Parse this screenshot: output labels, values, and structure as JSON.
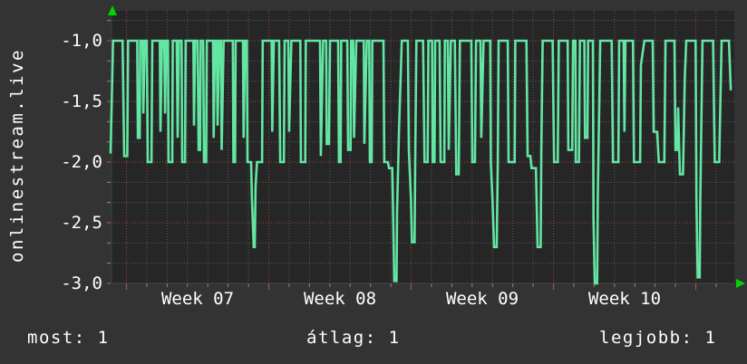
{
  "vertical_title": "onlinestream.live",
  "stats": {
    "left": "most: 1",
    "center": "átlag: 1",
    "right": "legjobb: 1"
  },
  "colors": {
    "background": "#333333",
    "canvas": "#262626",
    "grid_minor": "#5a5a5a",
    "grid_major": "#a04545",
    "line": "#63e6a3",
    "axis_arrow": "#00d400",
    "tick_minor": "#8a8a8a",
    "tick_major": "#c05050",
    "text": "#ffffff"
  },
  "chart_data": {
    "type": "line",
    "title": "",
    "ylabel_vertical": "onlinestream.live",
    "x_unit": "days",
    "xlim_days": [
      0,
      30.7
    ],
    "ylim": [
      -3.0,
      -1.0
    ],
    "grid": "dotted, minor every 1 day / 0.167 units, major (red) every 7 days / 0.5 units",
    "legend_position": "bottom",
    "y_ticks": [
      -1.0,
      -1.5,
      -2.0,
      -2.5,
      -3.0
    ],
    "y_tick_labels": [
      "-1,0",
      "-1,5",
      "-2,0",
      "-2,5",
      "-3,0"
    ],
    "x_tick_labels": [
      "Week 07",
      "Week 08",
      "Week 09",
      "Week 10"
    ],
    "week_boundaries_days": [
      0.78,
      7.78,
      14.78,
      21.78,
      28.78
    ],
    "series_name": "onlinestream.live",
    "points": [
      [
        0,
        -1.93
      ],
      [
        0.12,
        -1
      ],
      [
        0.59,
        -1
      ],
      [
        0.67,
        -1.95
      ],
      [
        0.82,
        -1.95
      ],
      [
        0.86,
        -1
      ],
      [
        1.31,
        -1
      ],
      [
        1.34,
        -1.8
      ],
      [
        1.43,
        -1.8
      ],
      [
        1.46,
        -1
      ],
      [
        1.57,
        -1
      ],
      [
        1.61,
        -1.6
      ],
      [
        1.68,
        -1
      ],
      [
        1.78,
        -1
      ],
      [
        1.83,
        -2
      ],
      [
        2.01,
        -2
      ],
      [
        2.05,
        -1
      ],
      [
        2.42,
        -1
      ],
      [
        2.45,
        -1.75
      ],
      [
        2.53,
        -1
      ],
      [
        2.64,
        -1
      ],
      [
        2.68,
        -1.6
      ],
      [
        2.73,
        -1
      ],
      [
        2.82,
        -1
      ],
      [
        2.85,
        -2
      ],
      [
        3.03,
        -2
      ],
      [
        3.06,
        -1
      ],
      [
        3.25,
        -1
      ],
      [
        3.3,
        -1.8
      ],
      [
        3.36,
        -1
      ],
      [
        3.49,
        -1
      ],
      [
        3.52,
        -2
      ],
      [
        3.66,
        -2
      ],
      [
        3.69,
        -1
      ],
      [
        4.07,
        -1
      ],
      [
        4.1,
        -1.7
      ],
      [
        4.16,
        -1
      ],
      [
        4.28,
        -1
      ],
      [
        4.33,
        -1.9
      ],
      [
        4.4,
        -1.9
      ],
      [
        4.43,
        -1
      ],
      [
        4.55,
        -1
      ],
      [
        4.59,
        -2
      ],
      [
        4.7,
        -2
      ],
      [
        4.73,
        -1
      ],
      [
        5.04,
        -1
      ],
      [
        5.07,
        -1.8
      ],
      [
        5.13,
        -1
      ],
      [
        5.22,
        -1
      ],
      [
        5.26,
        -1.7
      ],
      [
        5.34,
        -1
      ],
      [
        5.43,
        -1
      ],
      [
        5.46,
        -1.9
      ],
      [
        5.56,
        -1
      ],
      [
        6.01,
        -1
      ],
      [
        6.04,
        -2
      ],
      [
        6.12,
        -2
      ],
      [
        6.15,
        -1
      ],
      [
        6.51,
        -1
      ],
      [
        6.54,
        -1.8
      ],
      [
        6.61,
        -1
      ],
      [
        6.7,
        -1
      ],
      [
        6.73,
        -2
      ],
      [
        6.91,
        -2
      ],
      [
        6.95,
        -2.3
      ],
      [
        7.04,
        -2.7
      ],
      [
        7.09,
        -2.7
      ],
      [
        7.13,
        -2.2
      ],
      [
        7.2,
        -2
      ],
      [
        7.45,
        -2
      ],
      [
        7.48,
        -1
      ],
      [
        7.92,
        -1
      ],
      [
        7.95,
        -1.75
      ],
      [
        8.03,
        -1
      ],
      [
        8.29,
        -1
      ],
      [
        8.34,
        -2
      ],
      [
        8.52,
        -2
      ],
      [
        8.56,
        -1
      ],
      [
        8.74,
        -1
      ],
      [
        8.78,
        -1.75
      ],
      [
        8.89,
        -1
      ],
      [
        9.33,
        -1
      ],
      [
        9.36,
        -2
      ],
      [
        9.57,
        -2
      ],
      [
        9.6,
        -1
      ],
      [
        10.3,
        -1
      ],
      [
        10.34,
        -1.95
      ],
      [
        10.45,
        -1
      ],
      [
        10.6,
        -1
      ],
      [
        10.63,
        -1.85
      ],
      [
        10.74,
        -1.85
      ],
      [
        10.79,
        -1
      ],
      [
        11.19,
        -1
      ],
      [
        11.23,
        -2
      ],
      [
        11.31,
        -2
      ],
      [
        11.34,
        -1
      ],
      [
        11.64,
        -1
      ],
      [
        11.68,
        -1.9
      ],
      [
        11.8,
        -1.9
      ],
      [
        11.83,
        -1
      ],
      [
        11.93,
        -1
      ],
      [
        11.97,
        -1.8
      ],
      [
        12.08,
        -1
      ],
      [
        12.45,
        -1
      ],
      [
        12.48,
        -1.85
      ],
      [
        12.6,
        -1
      ],
      [
        12.72,
        -1
      ],
      [
        12.75,
        -2
      ],
      [
        12.84,
        -2
      ],
      [
        12.87,
        -1
      ],
      [
        13.42,
        -1
      ],
      [
        13.46,
        -2
      ],
      [
        13.64,
        -2
      ],
      [
        13.69,
        -2.05
      ],
      [
        13.85,
        -2.05
      ],
      [
        13.89,
        -2.4
      ],
      [
        13.95,
        -2.98
      ],
      [
        14.06,
        -2.98
      ],
      [
        14.09,
        -2.4
      ],
      [
        14.18,
        -1.75
      ],
      [
        14.32,
        -1
      ],
      [
        14.62,
        -1
      ],
      [
        14.67,
        -1.9
      ],
      [
        14.77,
        -2.3
      ],
      [
        14.82,
        -2.66
      ],
      [
        14.95,
        -2.66
      ],
      [
        14.98,
        -2
      ],
      [
        15.04,
        -1
      ],
      [
        15.37,
        -1
      ],
      [
        15.44,
        -2
      ],
      [
        15.59,
        -2
      ],
      [
        15.63,
        -1
      ],
      [
        15.81,
        -1
      ],
      [
        15.84,
        -2
      ],
      [
        15.93,
        -2
      ],
      [
        15.96,
        -1
      ],
      [
        16.18,
        -1
      ],
      [
        16.23,
        -2
      ],
      [
        16.41,
        -2
      ],
      [
        16.44,
        -1
      ],
      [
        16.58,
        -1
      ],
      [
        16.63,
        -1.9
      ],
      [
        16.73,
        -1
      ],
      [
        16.93,
        -1
      ],
      [
        17,
        -2.1
      ],
      [
        17.12,
        -2.1
      ],
      [
        17.18,
        -1
      ],
      [
        17.74,
        -1
      ],
      [
        17.79,
        -2
      ],
      [
        17.92,
        -2
      ],
      [
        17.97,
        -1
      ],
      [
        18.19,
        -1
      ],
      [
        18.23,
        -1.8
      ],
      [
        18.34,
        -1
      ],
      [
        18.67,
        -1
      ],
      [
        18.7,
        -2
      ],
      [
        18.78,
        -2.3
      ],
      [
        18.86,
        -2.7
      ],
      [
        18.99,
        -2.7
      ],
      [
        19.04,
        -2
      ],
      [
        19.08,
        -1
      ],
      [
        19.53,
        -1
      ],
      [
        19.57,
        -2
      ],
      [
        19.87,
        -2
      ],
      [
        19.9,
        -1
      ],
      [
        20.45,
        -1
      ],
      [
        20.51,
        -1.95
      ],
      [
        20.64,
        -1.95
      ],
      [
        20.7,
        -2.05
      ],
      [
        20.92,
        -2.05
      ],
      [
        21,
        -2.7
      ],
      [
        21.15,
        -2.7
      ],
      [
        21.18,
        -1.9
      ],
      [
        21.25,
        -1
      ],
      [
        21.74,
        -1
      ],
      [
        21.81,
        -2
      ],
      [
        21.99,
        -2
      ],
      [
        22.04,
        -1
      ],
      [
        22.48,
        -1
      ],
      [
        22.51,
        -1.9
      ],
      [
        22.7,
        -1.9
      ],
      [
        22.74,
        -1
      ],
      [
        22.86,
        -1
      ],
      [
        22.88,
        -2
      ],
      [
        23.03,
        -2
      ],
      [
        23.08,
        -1
      ],
      [
        23.3,
        -1
      ],
      [
        23.33,
        -1.8
      ],
      [
        23.45,
        -1.8
      ],
      [
        23.48,
        -1
      ],
      [
        23.72,
        -1
      ],
      [
        23.75,
        -2.47
      ],
      [
        23.81,
        -3
      ],
      [
        23.93,
        -3
      ],
      [
        23.96,
        -2.3
      ],
      [
        24.08,
        -1
      ],
      [
        24.64,
        -1
      ],
      [
        24.71,
        -2
      ],
      [
        24.97,
        -2
      ],
      [
        25.01,
        -1
      ],
      [
        25.23,
        -1
      ],
      [
        25.27,
        -1.75
      ],
      [
        25.32,
        -1
      ],
      [
        25.69,
        -1
      ],
      [
        25.74,
        -2
      ],
      [
        26.04,
        -2
      ],
      [
        26.08,
        -1.2
      ],
      [
        26.25,
        -1
      ],
      [
        26.66,
        -1
      ],
      [
        26.71,
        -1.75
      ],
      [
        26.88,
        -1.75
      ],
      [
        26.96,
        -2
      ],
      [
        27.23,
        -2
      ],
      [
        27.29,
        -1
      ],
      [
        27.73,
        -1
      ],
      [
        27.78,
        -1.9
      ],
      [
        27.88,
        -1.9
      ],
      [
        27.91,
        -1.55
      ],
      [
        28,
        -2.1
      ],
      [
        28.15,
        -2.1
      ],
      [
        28.24,
        -1.3
      ],
      [
        28.31,
        -1
      ],
      [
        28.77,
        -1
      ],
      [
        28.81,
        -2.3
      ],
      [
        28.87,
        -2.95
      ],
      [
        28.97,
        -2.95
      ],
      [
        29,
        -2.3
      ],
      [
        29.11,
        -1
      ],
      [
        29.63,
        -1
      ],
      [
        29.71,
        -2
      ],
      [
        29.93,
        -2
      ],
      [
        30.05,
        -1
      ],
      [
        30.41,
        -1
      ],
      [
        30.5,
        -1.4
      ],
      [
        30.55,
        -1.4
      ]
    ]
  }
}
